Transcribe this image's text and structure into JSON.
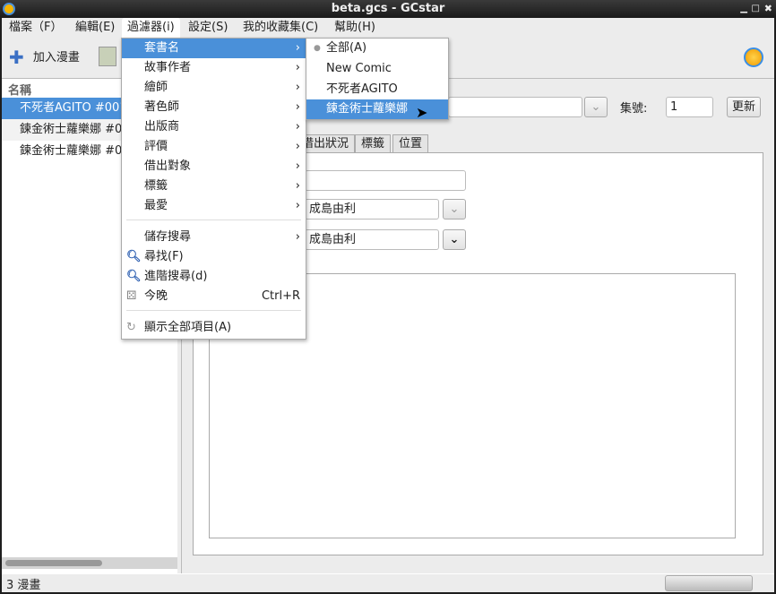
{
  "window": {
    "title": "beta.gcs - GCstar"
  },
  "menubar": [
    "檔案（F）",
    "編輯(E)",
    "過濾器(i)",
    "設定(S)",
    "我的收藏集(C)",
    "幫助(H)"
  ],
  "toolbar": {
    "add_label": "加入漫畫"
  },
  "list": {
    "header": "名稱",
    "rows": [
      "不死者AGITO #001",
      "鍊金術士蘿樂娜 #002",
      "鍊金術士蘿樂娜 #003"
    ]
  },
  "filter_menu": {
    "items": [
      "套書名",
      "故事作者",
      "繪師",
      "著色師",
      "出版商",
      "評價",
      "借出對象",
      "標籤",
      "最愛"
    ],
    "save_search": "儲存搜尋",
    "find": "尋找(F)",
    "advanced_search": "進階搜尋(d)",
    "tonight": "今晚",
    "tonight_shortcut": "Ctrl+R",
    "show_all": "顯示全部項目(A)"
  },
  "series_submenu": {
    "items": [
      "全部(A)",
      "New Comic",
      "不死者AGITO",
      "鍊金術士蘿樂娜"
    ],
    "selected_index": 3,
    "checked_index": 0
  },
  "details": {
    "episode_label": "集號:",
    "episode_value": "1",
    "update_button": "更新",
    "tabs": [
      "借出狀況",
      "標籤",
      "位置"
    ],
    "author_value": "成島由利",
    "artist_value": "成島由利"
  },
  "status": {
    "text": "3 漫畫"
  }
}
